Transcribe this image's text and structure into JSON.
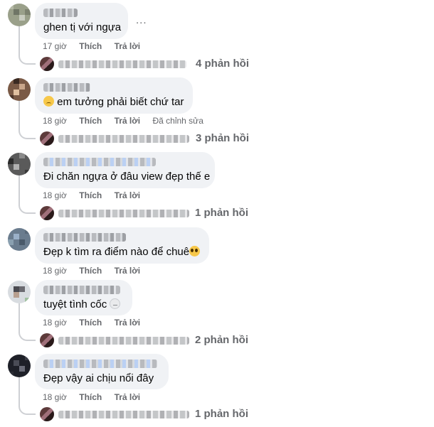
{
  "comments": [
    {
      "text": "ghen tị với ngựa",
      "emoji": "",
      "time": "17 giờ",
      "like": "Thích",
      "reply": "Trả lời",
      "edited": "",
      "more": "...",
      "replies": "4 phản hồi"
    },
    {
      "text": "em tưởng phải biết chứ tar",
      "emoji": "sad-face-emoji",
      "time": "18 giờ",
      "like": "Thích",
      "reply": "Trả lời",
      "edited": "Đã chỉnh sửa",
      "replies": "3 phản hồi"
    },
    {
      "text": "Đi chăn ngựa ở đâu view đẹp thế e",
      "emoji": "",
      "time": "18 giờ",
      "like": "Thích",
      "reply": "Trả lời",
      "edited": "",
      "replies": "1 phản hồi"
    },
    {
      "text": "Đẹp k tìm ra điểm nào để chuê",
      "emoji": "pleading-face-emoji",
      "time": "18 giờ",
      "like": "Thích",
      "reply": "Trả lời",
      "edited": "",
      "replies": ""
    },
    {
      "text": "tuyệt tình cốc",
      "emoji": "cold-face-emoji",
      "time": "18 giờ",
      "like": "Thích",
      "reply": "Trả lời",
      "edited": "",
      "replies": "2 phản hồi"
    },
    {
      "text": "Đẹp vậy ai chịu nổi đây",
      "emoji": "",
      "time": "18 giờ",
      "like": "Thích",
      "reply": "Trả lời",
      "edited": "",
      "replies": "1 phản hồi"
    }
  ]
}
